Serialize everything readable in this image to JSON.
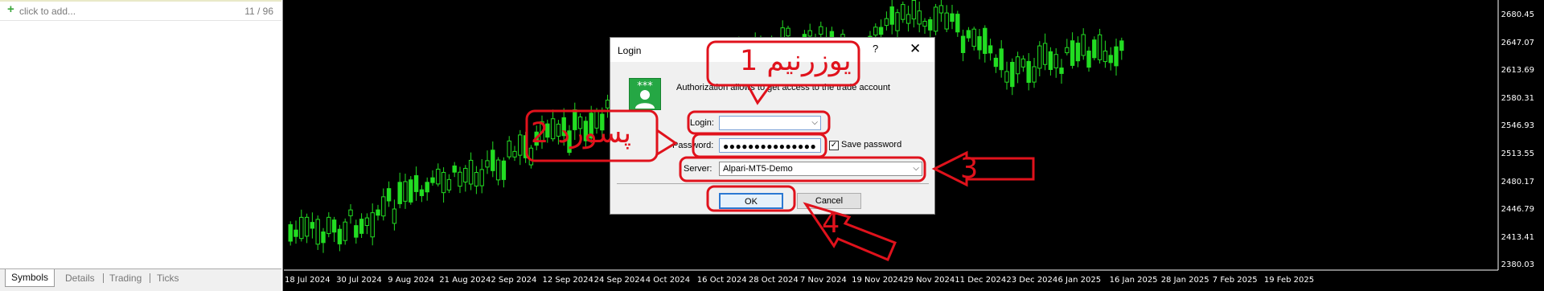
{
  "market_watch": {
    "add_label": "click to add...",
    "count": "11 / 96",
    "tabs": [
      "Symbols",
      "Details",
      "Trading",
      "Ticks"
    ],
    "active_tab": "Symbols"
  },
  "chart": {
    "price_labels": [
      "2680.45",
      "2647.07",
      "2613.69",
      "2580.31",
      "2546.93",
      "2513.55",
      "2480.17",
      "2446.79",
      "2413.41",
      "2380.03"
    ],
    "date_labels": [
      "18 Jul 2024",
      "30 Jul 2024",
      "9 Aug 2024",
      "21 Aug 2024",
      "2 Sep 2024",
      "12 Sep 2024",
      "24 Sep 2024",
      "4 Oct 2024",
      "16 Oct 2024",
      "28 Oct 2024",
      "7 Nov 2024",
      "19 Nov 2024",
      "29 Nov 2024",
      "11 Dec 2024",
      "23 Dec 2024",
      "6 Jan 2025",
      "16 Jan 2025",
      "28 Jan 2025",
      "7 Feb 2025",
      "19 Feb 2025"
    ],
    "candle_color": "#22dd22"
  },
  "dialog": {
    "title": "Login",
    "help": "?",
    "close": "✕",
    "auth_text": "Authorization allows to get access to the trade account",
    "login_label": "Login:",
    "login_value": "",
    "password_label": "Password:",
    "password_value": "●●●●●●●●●●●●●●●",
    "save_password_label": "Save password",
    "save_password_checked": "✓",
    "server_label": "Server:",
    "server_value": "Alpari-MT5-Demo",
    "ok_label": "OK",
    "cancel_label": "Cancel",
    "dropdown_glyph": "⌵"
  },
  "annotations": {
    "color": "#e0121c",
    "step1": "1 یوزرنیم",
    "step2": "2 پسورد",
    "step3": "3",
    "step4": "4"
  }
}
